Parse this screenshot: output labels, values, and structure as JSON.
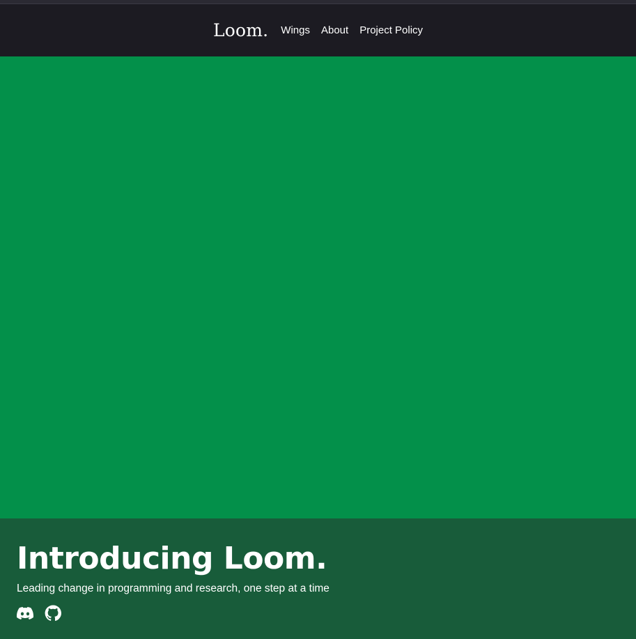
{
  "navbar": {
    "brand": "Loom.",
    "links": [
      {
        "label": "Wings"
      },
      {
        "label": "About"
      },
      {
        "label": "Project Policy"
      }
    ]
  },
  "hero": {
    "background_color": "#03904a"
  },
  "footer": {
    "headline": "Introducing Loom.",
    "tagline": "Leading change in programming and research, one step at a time",
    "socials": [
      {
        "icon": "discord-icon"
      },
      {
        "icon": "github-icon"
      }
    ],
    "background_color": "#185c3a"
  }
}
